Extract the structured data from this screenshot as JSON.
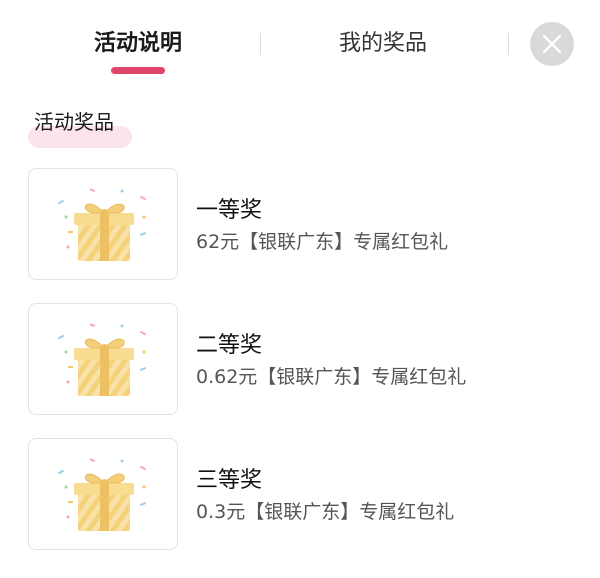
{
  "tabs": [
    {
      "label": "活动说明",
      "active": true
    },
    {
      "label": "我的奖品",
      "active": false
    }
  ],
  "close_icon": "close-icon",
  "accent_color": "#e0456a",
  "section": {
    "title": "活动奖品"
  },
  "prizes": [
    {
      "name": "一等奖",
      "desc": "62元【银联广东】专属红包礼",
      "icon": "gift-box-icon"
    },
    {
      "name": "二等奖",
      "desc": "0.62元【银联广东】专属红包礼",
      "icon": "gift-box-icon"
    },
    {
      "name": "三等奖",
      "desc": "0.3元【银联广东】专属红包礼",
      "icon": "gift-box-icon"
    }
  ]
}
